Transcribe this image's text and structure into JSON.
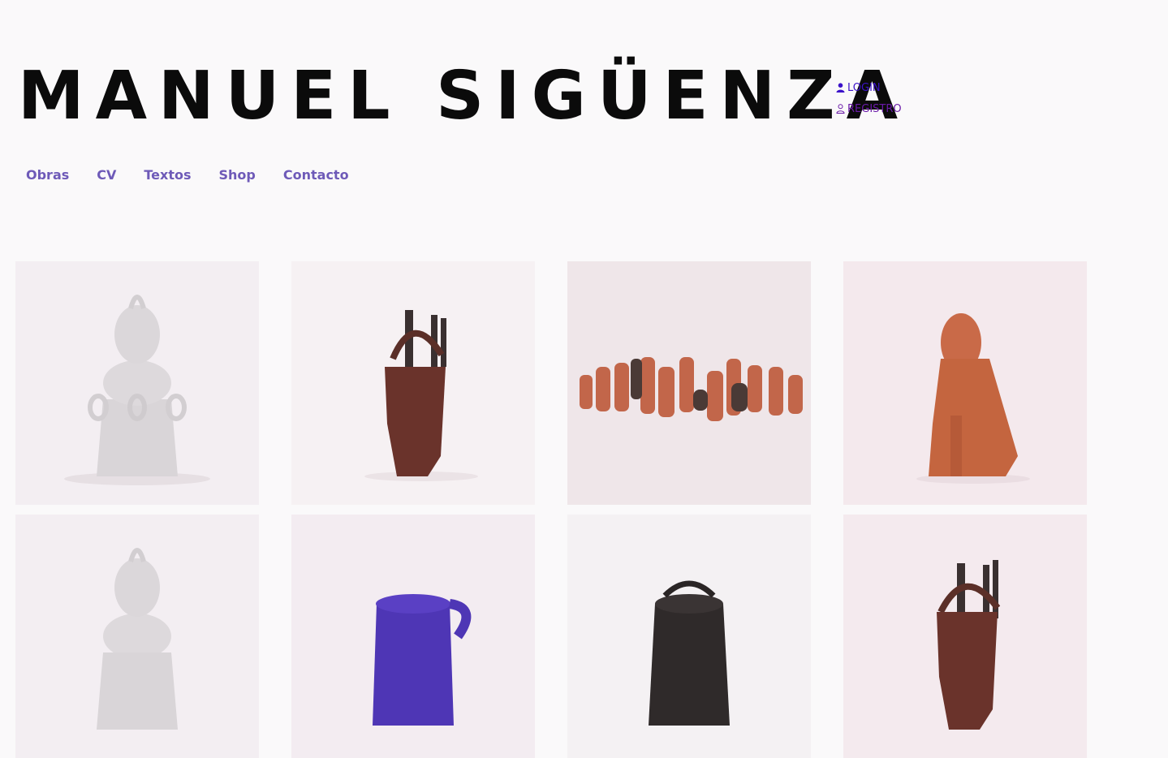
{
  "site": {
    "title": "MANUEL SIGÜENZA"
  },
  "auth": {
    "login_label": "LOGIN",
    "register_label": "REGISTRO"
  },
  "nav": {
    "items": [
      "Obras",
      "CV",
      "Textos",
      "Shop",
      "Contacto"
    ]
  },
  "gallery": {
    "items": [
      {
        "subject": "white-textured-lidded-vessel",
        "background": "#f3eef2"
      },
      {
        "subject": "brown-head-vessel-with-tools",
        "background": "#f6f1f3"
      },
      {
        "subject": "group-of-terracotta-figures",
        "background": "#efe6e9"
      },
      {
        "subject": "terracotta-seated-dog",
        "background": "#f4e9ed"
      },
      {
        "subject": "white-textured-lidded-vessel",
        "background": "#f3eef2"
      },
      {
        "subject": "purple-jug",
        "background": "#f3ecf1"
      },
      {
        "subject": "black-vessel",
        "background": "#f4f1f3"
      },
      {
        "subject": "brown-head-vessel-with-tools",
        "background": "#f4eaee"
      }
    ]
  },
  "colors": {
    "accent": "#6e5ab8",
    "login": "#3b12c9",
    "registro": "#6a1aa8",
    "text": "#0b0b0b"
  }
}
